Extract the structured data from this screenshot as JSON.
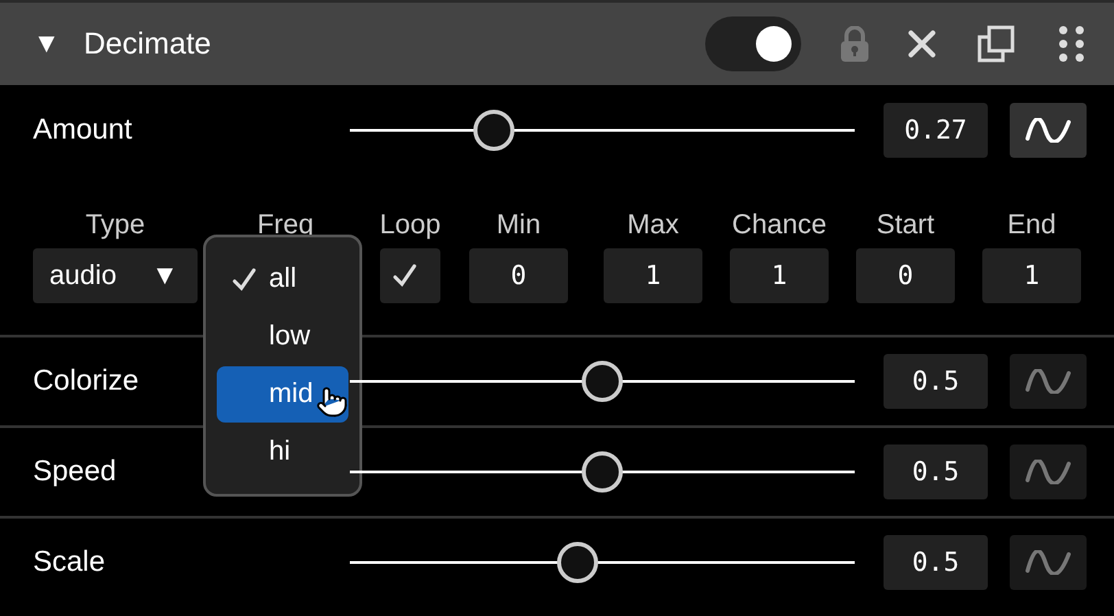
{
  "panel": {
    "caret": "▼",
    "title": "Decimate",
    "expanded": true,
    "enabled": true,
    "locked": false
  },
  "amount": {
    "label": "Amount",
    "level": 0.285,
    "value": "0.27",
    "modulated": true
  },
  "params": [
    {
      "kind": "select",
      "label": "Type",
      "value": "audio",
      "caret": "▼"
    },
    {
      "kind": "menu",
      "label": "Freq",
      "options": [
        {
          "label": "all",
          "checked": true,
          "selected": false
        },
        {
          "label": "low",
          "checked": false,
          "selected": false
        },
        {
          "label": "mid",
          "checked": false,
          "selected": true
        },
        {
          "label": "hi",
          "checked": false,
          "selected": false
        }
      ]
    },
    {
      "kind": "checkbox",
      "label": "Loop",
      "checked": true
    },
    {
      "kind": "number",
      "label": "Min",
      "value": "0"
    },
    {
      "kind": "number",
      "label": "Max",
      "value": "1"
    },
    {
      "kind": "number",
      "label": "Chance",
      "value": "1"
    },
    {
      "kind": "number",
      "label": "Start",
      "value": "0"
    },
    {
      "kind": "number",
      "label": "End",
      "value": "1"
    }
  ],
  "sliders": [
    {
      "label": "Colorize",
      "level": 0.5,
      "value": "0.5",
      "modulated": false
    },
    {
      "label": "Speed",
      "level": 0.5,
      "value": "0.5",
      "modulated": false
    },
    {
      "label": "Scale",
      "level": 0.45,
      "value": "0.5",
      "modulated": false
    }
  ]
}
